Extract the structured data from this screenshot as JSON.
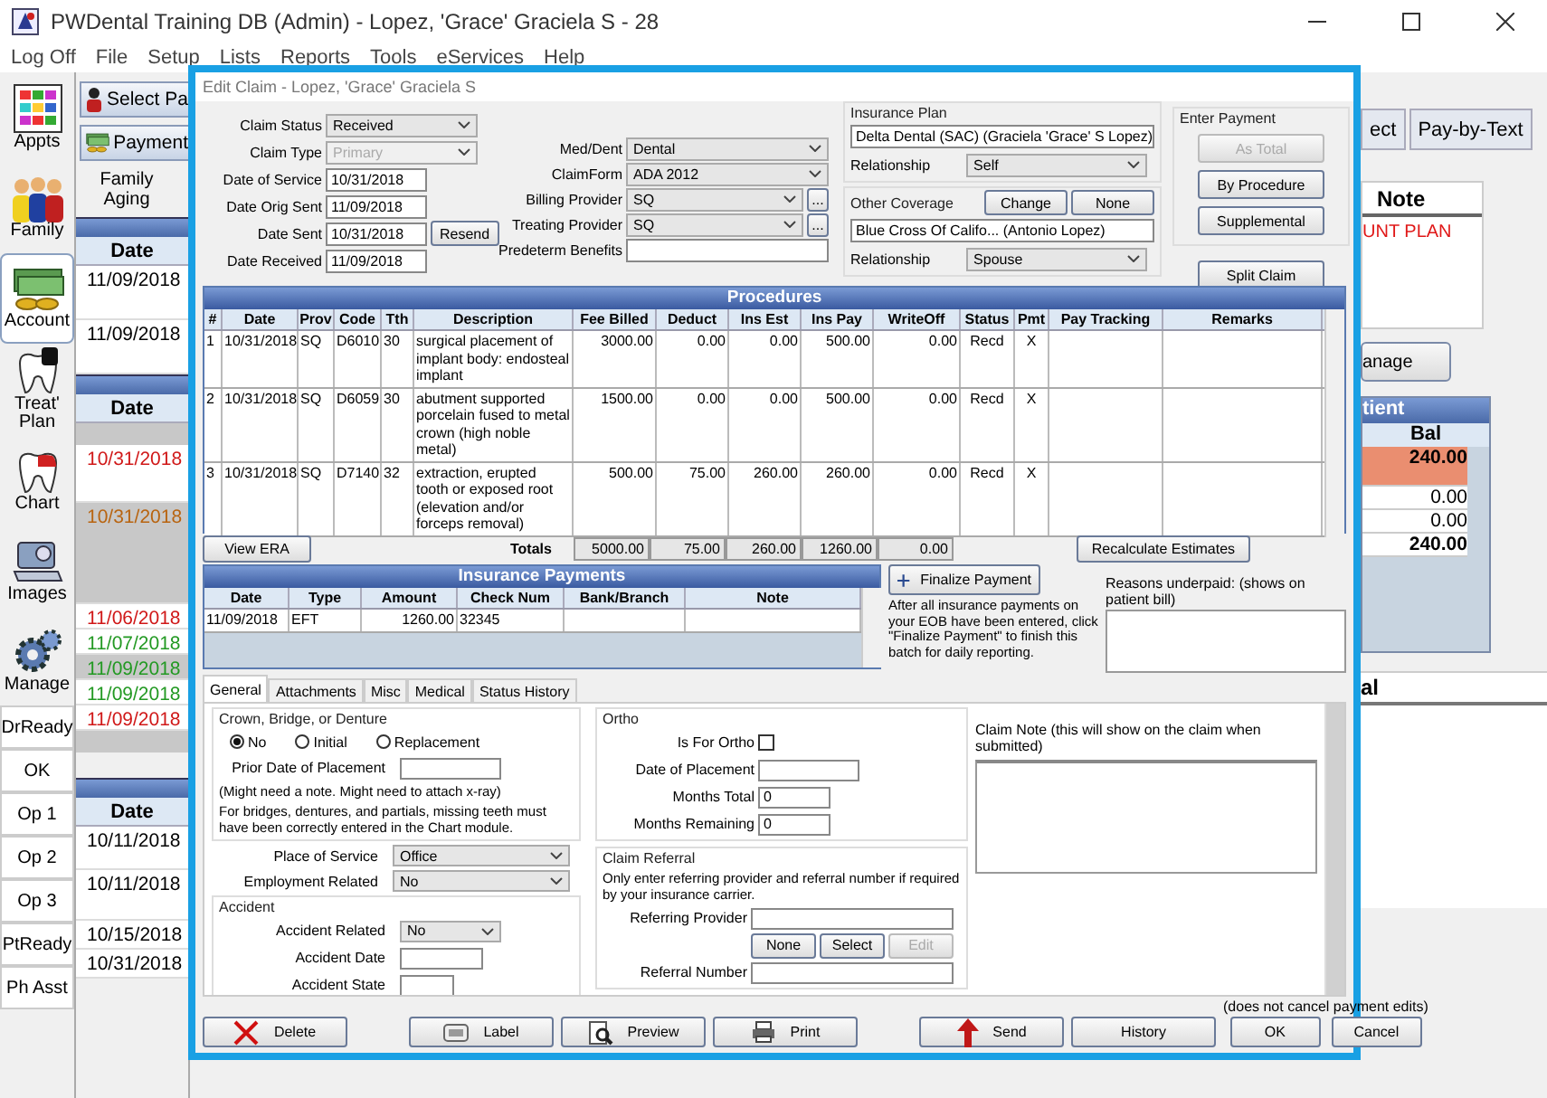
{
  "window": {
    "title": "PWDental Training DB (Admin) - Lopez, 'Grace' Graciela S - 28"
  },
  "menu": [
    "Log Off",
    "File",
    "Setup",
    "Lists",
    "Reports",
    "Tools",
    "eServices",
    "Help"
  ],
  "modules": [
    {
      "label": "Appts",
      "kind": "calendar",
      "selected": false
    },
    {
      "label": "Family",
      "kind": "family",
      "selected": false
    },
    {
      "label": "Account",
      "kind": "money",
      "selected": true
    },
    {
      "label": "Treat' Plan",
      "kind": "treatment",
      "selected": false
    },
    {
      "label": "Chart",
      "kind": "tooth",
      "selected": false
    },
    {
      "label": "Images",
      "kind": "camera",
      "selected": false
    },
    {
      "label": "Manage",
      "kind": "gear",
      "selected": false
    }
  ],
  "status_list": [
    "DrReady",
    "OK",
    "Op 1",
    "Op 2",
    "Op 3",
    "PtReady",
    "Ph Asst"
  ],
  "account_panel": {
    "buttons": [
      {
        "label": "Select Pa",
        "kind": "person"
      },
      {
        "label": "Payment",
        "kind": "money"
      }
    ],
    "aging_label": "Family Aging",
    "grids": [
      {
        "header": "Date",
        "rows": [
          {
            "date": "11/09/2018",
            "color": "#000000",
            "selected": false
          },
          {
            "date": "11/09/2018",
            "color": "#000000",
            "selected": false
          }
        ]
      },
      {
        "header": "Date",
        "rows": [
          {
            "date": "10/31/2018",
            "color": "#d01818",
            "selected": false
          },
          {
            "date": "10/31/2018",
            "color": "#b86410",
            "selected": true
          },
          {
            "date": "11/06/2018",
            "color": "#d01818",
            "selected": false
          },
          {
            "date": "11/07/2018",
            "color": "#229922",
            "selected": false
          },
          {
            "date": "11/09/2018",
            "color": "#229922",
            "selected": true
          },
          {
            "date": "11/09/2018",
            "color": "#229922",
            "selected": false
          },
          {
            "date": "11/09/2018",
            "color": "#d01818",
            "selected": false
          }
        ]
      },
      {
        "header": "Date",
        "rows": [
          {
            "date": "10/11/2018",
            "color": "#000000",
            "selected": false
          },
          {
            "date": "10/11/2018",
            "color": "#000000",
            "selected": false
          },
          {
            "date": "10/15/2018",
            "color": "#000000",
            "selected": false
          },
          {
            "date": "10/31/2018",
            "color": "#000000",
            "selected": false
          }
        ]
      }
    ]
  },
  "right_panel": {
    "tabs": [
      "ect",
      "Pay-by-Text"
    ],
    "note_title": "Note",
    "note_text": "UNT PLAN",
    "manage_button": "anage",
    "patient_title": "tient",
    "bal_header": "Bal",
    "bal_rows": [
      {
        "value": "240.00",
        "kind": "highlight"
      },
      {
        "value": "0.00",
        "kind": "normal"
      },
      {
        "value": "0.00",
        "kind": "normal"
      },
      {
        "value": "240.00",
        "kind": "total"
      }
    ],
    "section_title": "al"
  },
  "dialog": {
    "title": "Edit Claim - Lopez, 'Grace' Graciela S",
    "claim_fields": [
      {
        "label": "Claim Status",
        "kind": "select",
        "value": "Received",
        "disabled": false
      },
      {
        "label": "Claim Type",
        "kind": "select",
        "value": "Primary",
        "disabled": true
      },
      {
        "label": "Date of Service",
        "kind": "text",
        "value": "10/31/2018",
        "disabled": false
      },
      {
        "label": "Date Orig Sent",
        "kind": "text",
        "value": "11/09/2018",
        "disabled": false
      },
      {
        "label": "Date Sent",
        "kind": "text",
        "value": "10/31/2018",
        "button": "Resend",
        "disabled": false
      },
      {
        "label": "Date Received",
        "kind": "text",
        "value": "11/09/2018",
        "disabled": false
      }
    ],
    "claim_fields_2": [
      {
        "label": "Med/Dent",
        "kind": "select",
        "value": "Dental"
      },
      {
        "label": "ClaimForm",
        "kind": "select",
        "value": "ADA 2012"
      },
      {
        "label": "Billing Provider",
        "kind": "select_more",
        "value": "SQ",
        "button": "..."
      },
      {
        "label": "Treating Provider",
        "kind": "select_more",
        "value": "SQ",
        "button": "..."
      },
      {
        "label": "Predeterm Benefits",
        "kind": "text"
      }
    ],
    "insurance_plan": {
      "title": "Insurance Plan",
      "plan": "Delta Dental (SAC) (Graciela 'Grace' S Lopez)",
      "relationship_label": "Relationship",
      "relationship": "Self"
    },
    "other_coverage": {
      "title": "Other Coverage",
      "buttons": [
        "Change",
        "None"
      ],
      "plan": "Blue Cross Of Califo... (Antonio Lopez)",
      "relationship_label": "Relationship",
      "relationship": "Spouse"
    },
    "enter_payment": {
      "title": "Enter Payment",
      "buttons": [
        {
          "label": "As Total",
          "disabled": true
        },
        {
          "label": "By Procedure",
          "disabled": false
        },
        {
          "label": "Supplemental",
          "disabled": false
        }
      ]
    },
    "split_claim": "Split Claim",
    "procedures": {
      "title": "Procedures",
      "columns": [
        "#",
        "Date",
        "Prov",
        "Code",
        "Tth",
        "Description",
        "Fee Billed",
        "Deduct",
        "Ins Est",
        "Ins Pay",
        "WriteOff",
        "Status",
        "Pmt",
        "Pay Tracking",
        "Remarks"
      ],
      "rows": [
        {
          "cells": [
            "1",
            "10/31/2018",
            "SQ",
            "D6010",
            "30",
            "surgical placement of implant body: endosteal implant",
            "3000.00",
            "0.00",
            "0.00",
            "500.00",
            "0.00",
            "Recd",
            "X"
          ]
        },
        {
          "cells": [
            "2",
            "10/31/2018",
            "SQ",
            "D6059",
            "30",
            "abutment supported porcelain fused to metal crown (high noble metal)",
            "1500.00",
            "0.00",
            "0.00",
            "500.00",
            "0.00",
            "Recd",
            "X"
          ]
        },
        {
          "cells": [
            "3",
            "10/31/2018",
            "SQ",
            "D7140",
            "32",
            "extraction, erupted tooth or exposed root (elevation and/or forceps removal)",
            "500.00",
            "75.00",
            "260.00",
            "260.00",
            "0.00",
            "Recd",
            "X"
          ]
        }
      ]
    },
    "view_era": "View ERA",
    "totals": {
      "label": "Totals",
      "values": [
        "5000.00",
        "75.00",
        "260.00",
        "1260.00",
        "0.00"
      ]
    },
    "recalculate": "Recalculate Estimates",
    "insurance_payments": {
      "title": "Insurance Payments",
      "columns": [
        "Date",
        "Type",
        "Amount",
        "Check Num",
        "Bank/Branch",
        "Note"
      ],
      "rows": [
        {
          "cells": [
            "11/09/2018",
            "EFT",
            "1260.00",
            "32345"
          ]
        }
      ]
    },
    "finalize": {
      "button": "Finalize Payment",
      "note": "After all insurance payments on your EOB have been entered, click \"Finalize Payment\" to finish this batch for daily reporting."
    },
    "reasons_underpaid": {
      "label": "Reasons underpaid:  (shows on patient bill)"
    },
    "tabs": [
      {
        "label": "General",
        "selected": true
      },
      {
        "label": "Attachments",
        "selected": false
      },
      {
        "label": "Misc",
        "selected": false
      },
      {
        "label": "Medical",
        "selected": false
      },
      {
        "label": "Status History",
        "selected": false
      }
    ],
    "crown": {
      "title": "Crown, Bridge, or Denture",
      "options": [
        {
          "label": "No",
          "selected": true
        },
        {
          "label": "Initial",
          "selected": false
        },
        {
          "label": "Replacement",
          "selected": false
        }
      ],
      "prior_date_label": "Prior Date of Placement",
      "note1": "(Might need a note. Might need to attach x-ray)",
      "note2": "For bridges, dentures, and partials, missing teeth must have been correctly entered in the Chart module."
    },
    "place_of_service": {
      "label": "Place of Service",
      "value": "Office"
    },
    "employment_related": {
      "label": "Employment Related",
      "value": "No"
    },
    "accident": {
      "title": "Accident",
      "related_label": "Accident Related",
      "related": "No",
      "date_label": "Accident Date",
      "state_label": "Accident State"
    },
    "ortho": {
      "title": "Ortho",
      "is_for_ortho_label": "Is For Ortho",
      "is_for_ortho": false,
      "date_label": "Date of Placement",
      "months_total_label": "Months Total",
      "months_total": "0",
      "months_remaining_label": "Months Remaining",
      "months_remaining": "0"
    },
    "claim_referral": {
      "title": "Claim Referral",
      "note": "Only enter referring provider and referral number if required by your insurance carrier.",
      "provider_label": "Referring Provider",
      "buttons": [
        {
          "label": "None",
          "disabled": false
        },
        {
          "label": "Select",
          "disabled": false
        },
        {
          "label": "Edit",
          "disabled": true
        }
      ],
      "number_label": "Referral Number"
    },
    "claim_note": {
      "label": "Claim Note (this will show on the claim when submitted)"
    },
    "bottom_buttons": [
      {
        "label": "Delete",
        "kind": "delete"
      },
      {
        "label": "Label",
        "kind": "label"
      },
      {
        "label": "Preview",
        "kind": "preview"
      },
      {
        "label": "Print",
        "kind": "print"
      },
      {
        "label": "Send",
        "kind": "send"
      },
      {
        "label": "History",
        "kind": "plain"
      }
    ],
    "cancel_note": "(does not cancel payment edits)",
    "ok": "OK",
    "cancel": "Cancel"
  }
}
